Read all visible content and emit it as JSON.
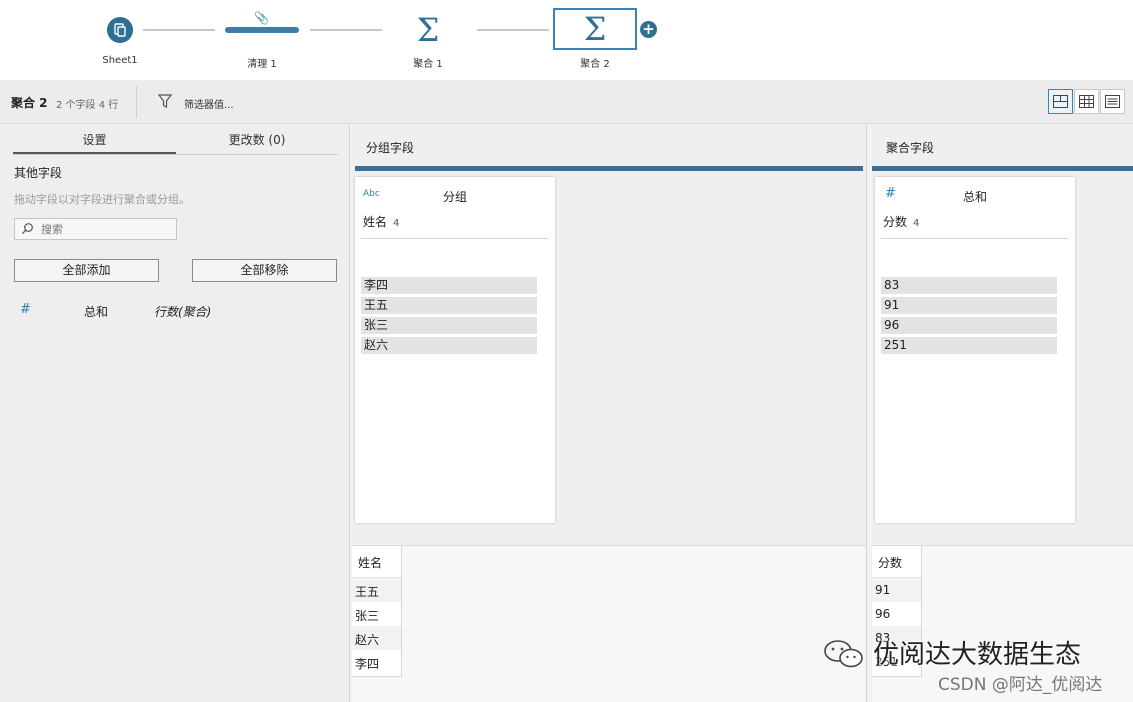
{
  "flow": {
    "nodes": [
      {
        "label": "Sheet1",
        "icon": "sheet-icon"
      },
      {
        "label": "清理 1",
        "icon": "clean-icon"
      },
      {
        "label": "聚合 1",
        "icon": "sigma-icon"
      },
      {
        "label": "聚合 2",
        "icon": "sigma-icon",
        "selected": true
      }
    ],
    "add_icon": "plus-icon"
  },
  "toolbar": {
    "title": "聚合 2",
    "meta": "2 个字段  4 行",
    "filter_label": "筛选器值...",
    "view_modes": [
      "split-view-icon",
      "table-view-icon",
      "list-view-icon"
    ]
  },
  "left": {
    "tabs": [
      "设置",
      "更改数 (0)"
    ],
    "heading": "其他字段",
    "hint": "拖动字段以对字段进行聚合或分组。",
    "search_placeholder": "搜索",
    "add_all": "全部添加",
    "remove_all": "全部移除",
    "field_row": {
      "type_symbol": "#",
      "aggregation": "总和",
      "field": "行数(聚合)"
    }
  },
  "group_pane": {
    "title": "分组字段",
    "card": {
      "type_label": "Abc",
      "role": "分组",
      "field": "姓名",
      "count": "4",
      "values": [
        "李四",
        "王五",
        "张三",
        "赵六"
      ]
    }
  },
  "agg_pane": {
    "title": "聚合字段",
    "card": {
      "type_label": "#",
      "role": "总和",
      "field": "分数",
      "count": "4",
      "values": [
        "83",
        "91",
        "96",
        "251"
      ]
    }
  },
  "grid_left": {
    "header": "姓名",
    "rows": [
      "王五",
      "张三",
      "赵六",
      "李四"
    ]
  },
  "grid_right": {
    "header": "分数",
    "rows": [
      "91",
      "96",
      "83",
      "251"
    ]
  },
  "watermark": {
    "main": "优阅达大数据生态",
    "sub": "CSDN @阿达_优阅达"
  },
  "colors": {
    "accent": "#2e6f94",
    "rule": "#3d6f96",
    "type_blue": "#2e7fb6"
  }
}
